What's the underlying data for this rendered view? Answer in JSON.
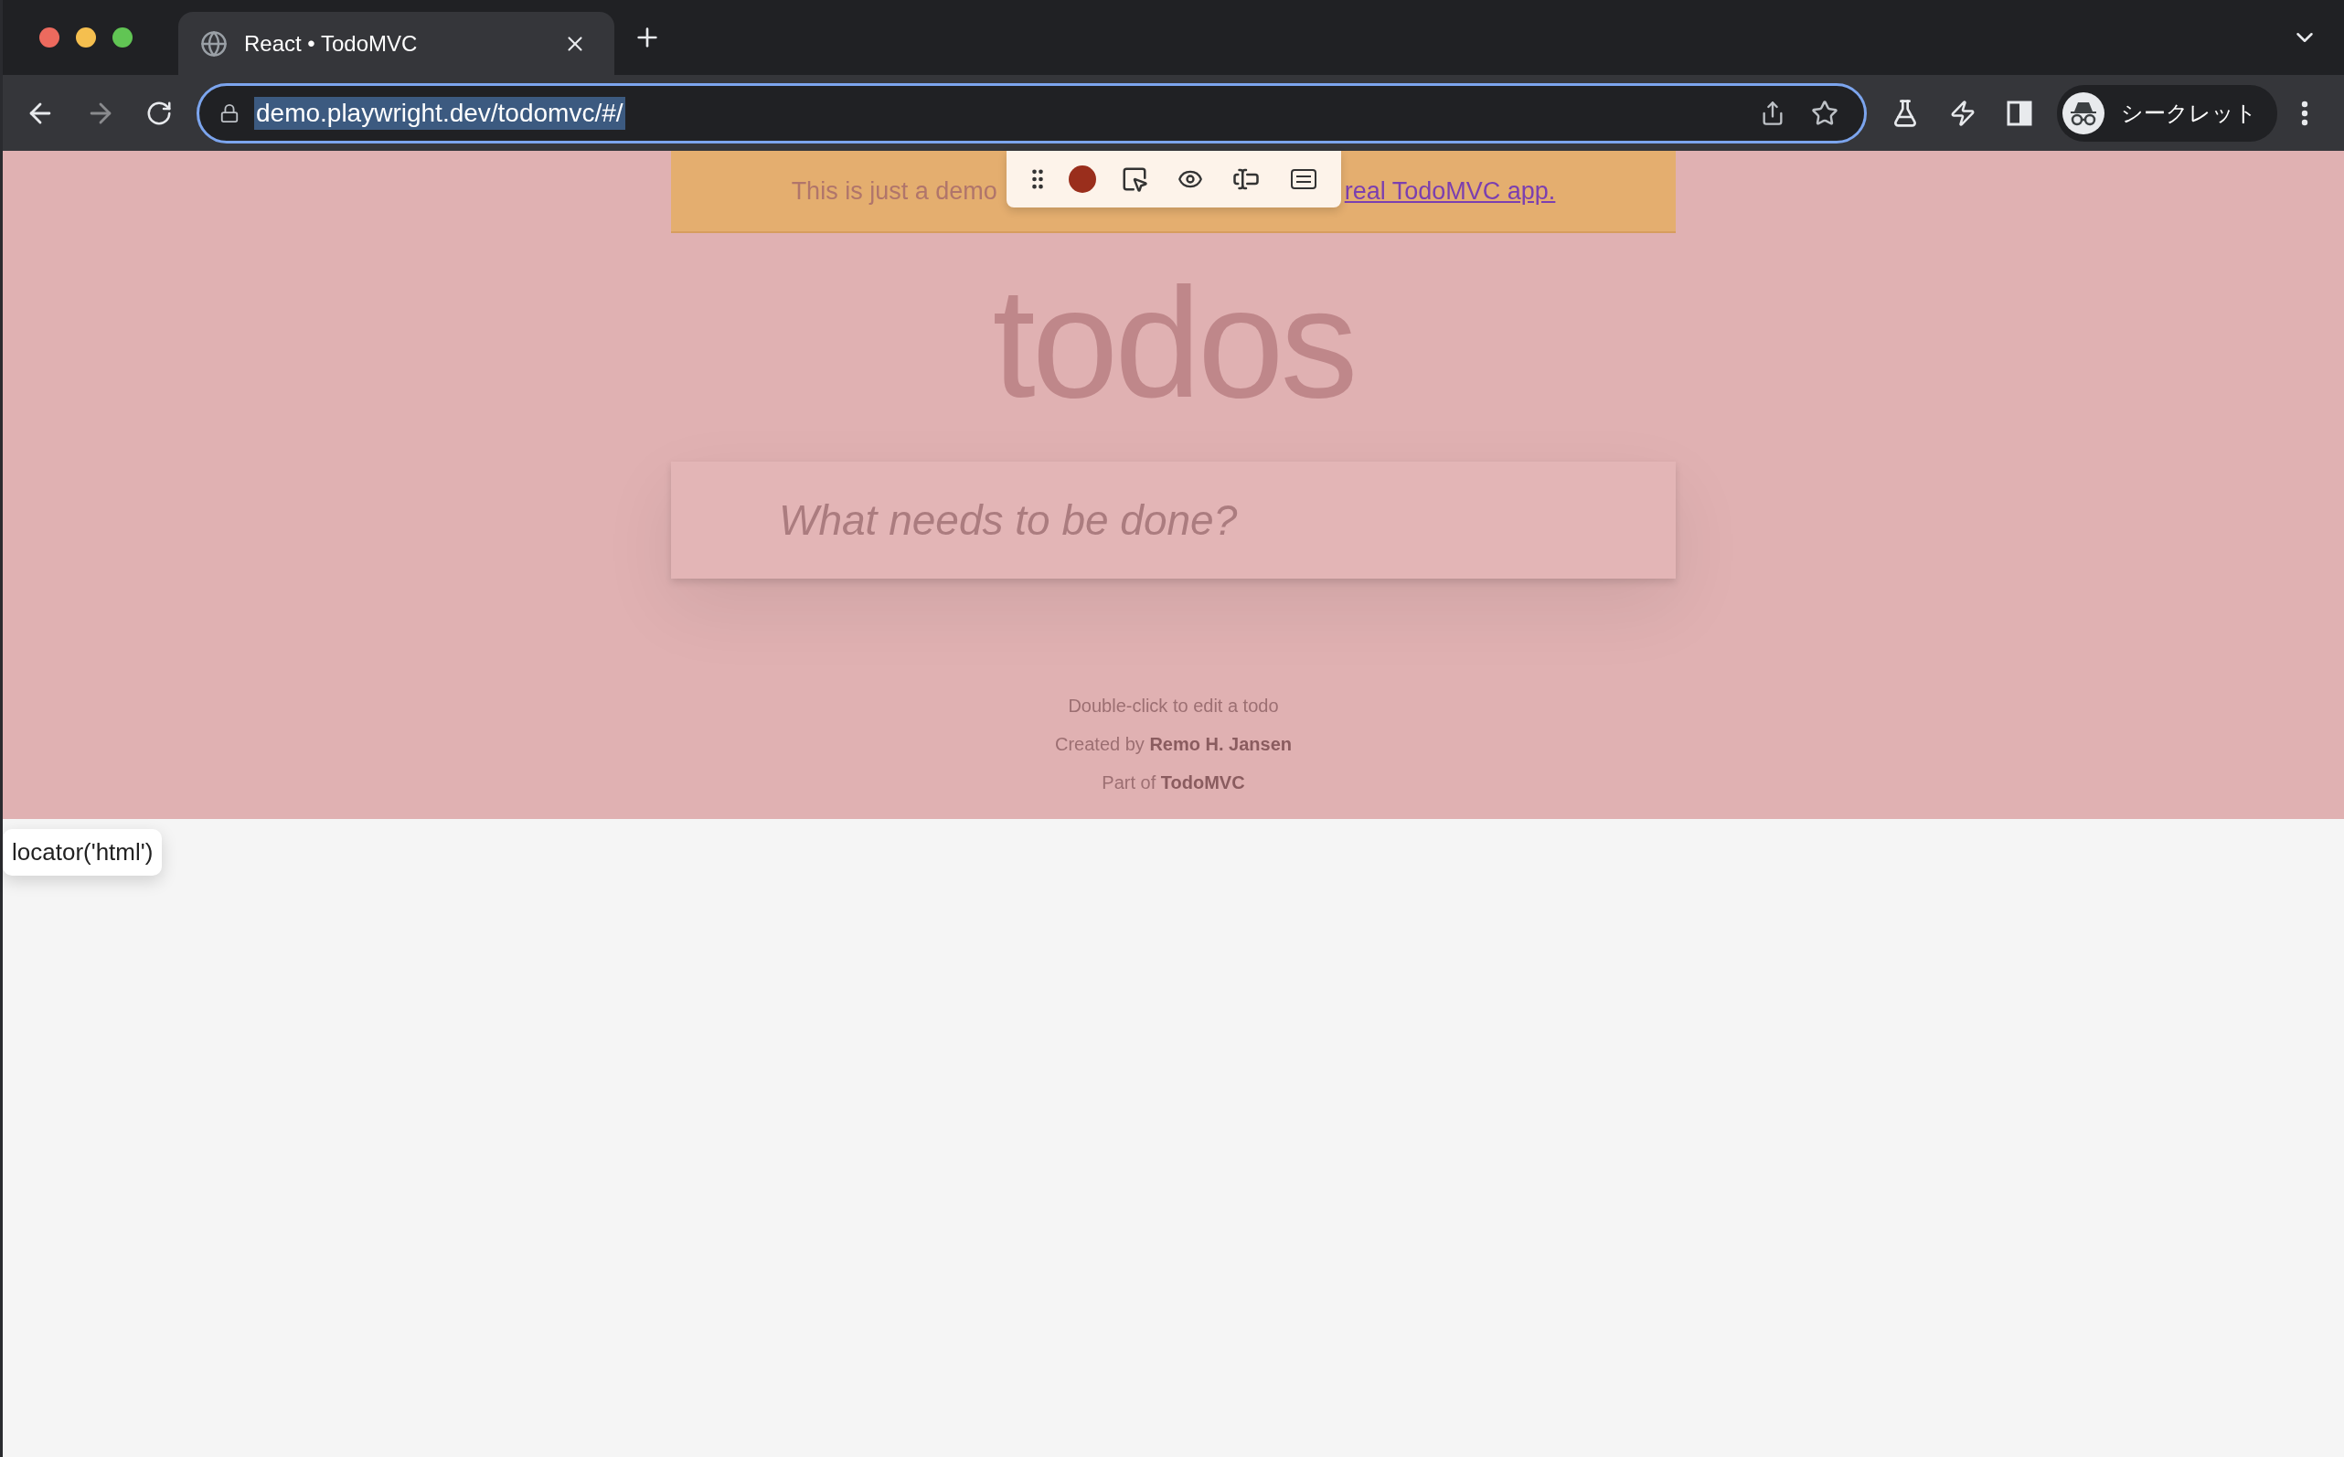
{
  "browser": {
    "tab_title": "React • TodoMVC",
    "url": "demo.playwright.dev/todomvc/#/",
    "profile_label": "シークレット"
  },
  "banner": {
    "text": "This is just a demo",
    "link": "real TodoMVC app."
  },
  "heading": "todos",
  "new_todo": {
    "placeholder": "What needs to be done?"
  },
  "footer": [
    {
      "text": "Double-click to edit a todo"
    },
    {
      "prefix": "Created by ",
      "link": "Remo H. Jansen"
    },
    {
      "prefix": "Part of ",
      "link": "TodoMVC"
    }
  ],
  "locator_tooltip": "locator('html')"
}
